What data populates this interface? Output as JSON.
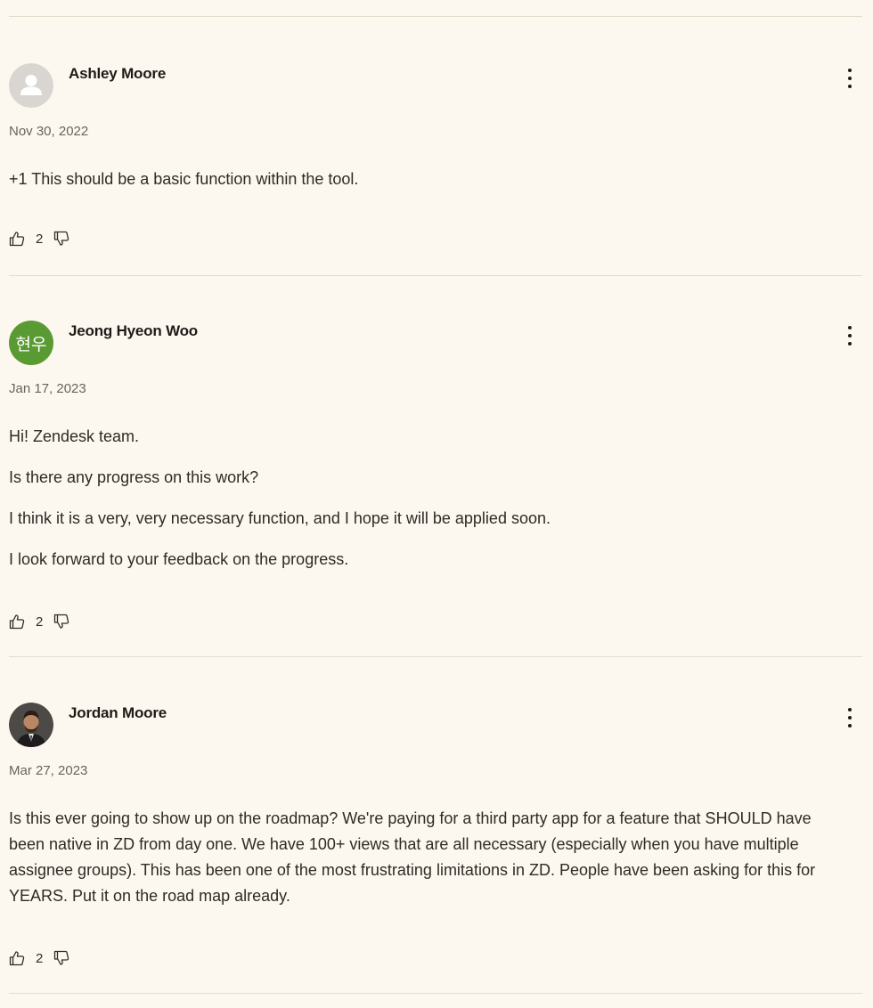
{
  "comments": [
    {
      "author": "Ashley Moore",
      "avatar": {
        "type": "placeholder",
        "icon": "user-placeholder-icon"
      },
      "date": "Nov 30, 2022",
      "paragraphs": [
        "+1 This should be a basic function within the tool."
      ],
      "votes": "2",
      "menu_icon": "more-vertical-icon"
    },
    {
      "author": "Jeong Hyeon Woo",
      "avatar": {
        "type": "initials",
        "initials": "현우",
        "color": "#5a9a32"
      },
      "date": "Jan 17, 2023",
      "paragraphs": [
        "Hi! Zendesk team.",
        "Is there any progress on this work?",
        "I think it is a very, very necessary function, and I hope it will be applied soon.",
        "I look forward to your feedback on the progress."
      ],
      "votes": "2",
      "menu_icon": "more-vertical-icon"
    },
    {
      "author": "Jordan Moore",
      "avatar": {
        "type": "photo",
        "icon": "profile-photo"
      },
      "date": "Mar 27, 2023",
      "paragraphs": [
        "Is this ever going to show up on the roadmap? We're paying for a third party app for a feature that SHOULD have been native in ZD from day one. We have 100+ views that are all necessary (especially when you have multiple assignee groups). This has been one of the most frustrating limitations in ZD. People have been asking for this for YEARS. Put it on the road map already."
      ],
      "votes": "2",
      "menu_icon": "more-vertical-icon"
    }
  ],
  "colors": {
    "background": "#fdf8ef",
    "divider": "#e3dccd",
    "text": "#2f2a26",
    "meta_text": "#6b635b"
  }
}
